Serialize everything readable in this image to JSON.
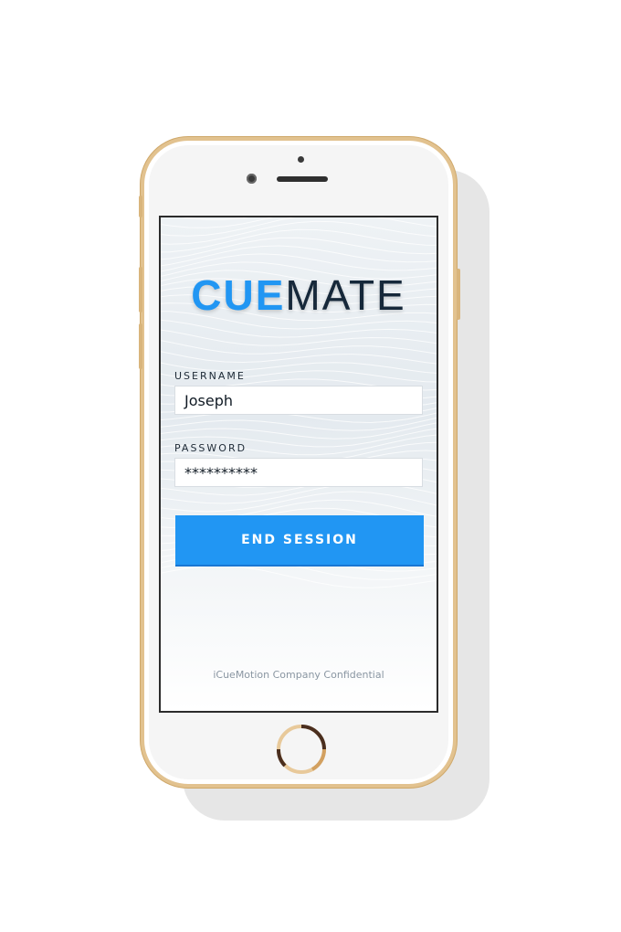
{
  "app": {
    "logo_primary": "CUE",
    "logo_secondary": "MATE"
  },
  "form": {
    "username_label": "USERNAME",
    "username_value": "Joseph",
    "password_label": "PASSWORD",
    "password_value": "**********",
    "submit_label": "END SESSION"
  },
  "footer": {
    "text": "iCueMotion Company Confidential"
  },
  "colors": {
    "accent": "#2196f3",
    "logo_dark": "#16283a",
    "phone_gold": "#e2c28f"
  },
  "icons": {
    "home_button": "home-button-icon",
    "camera": "front-camera-icon",
    "speaker": "earpiece-speaker-icon"
  }
}
